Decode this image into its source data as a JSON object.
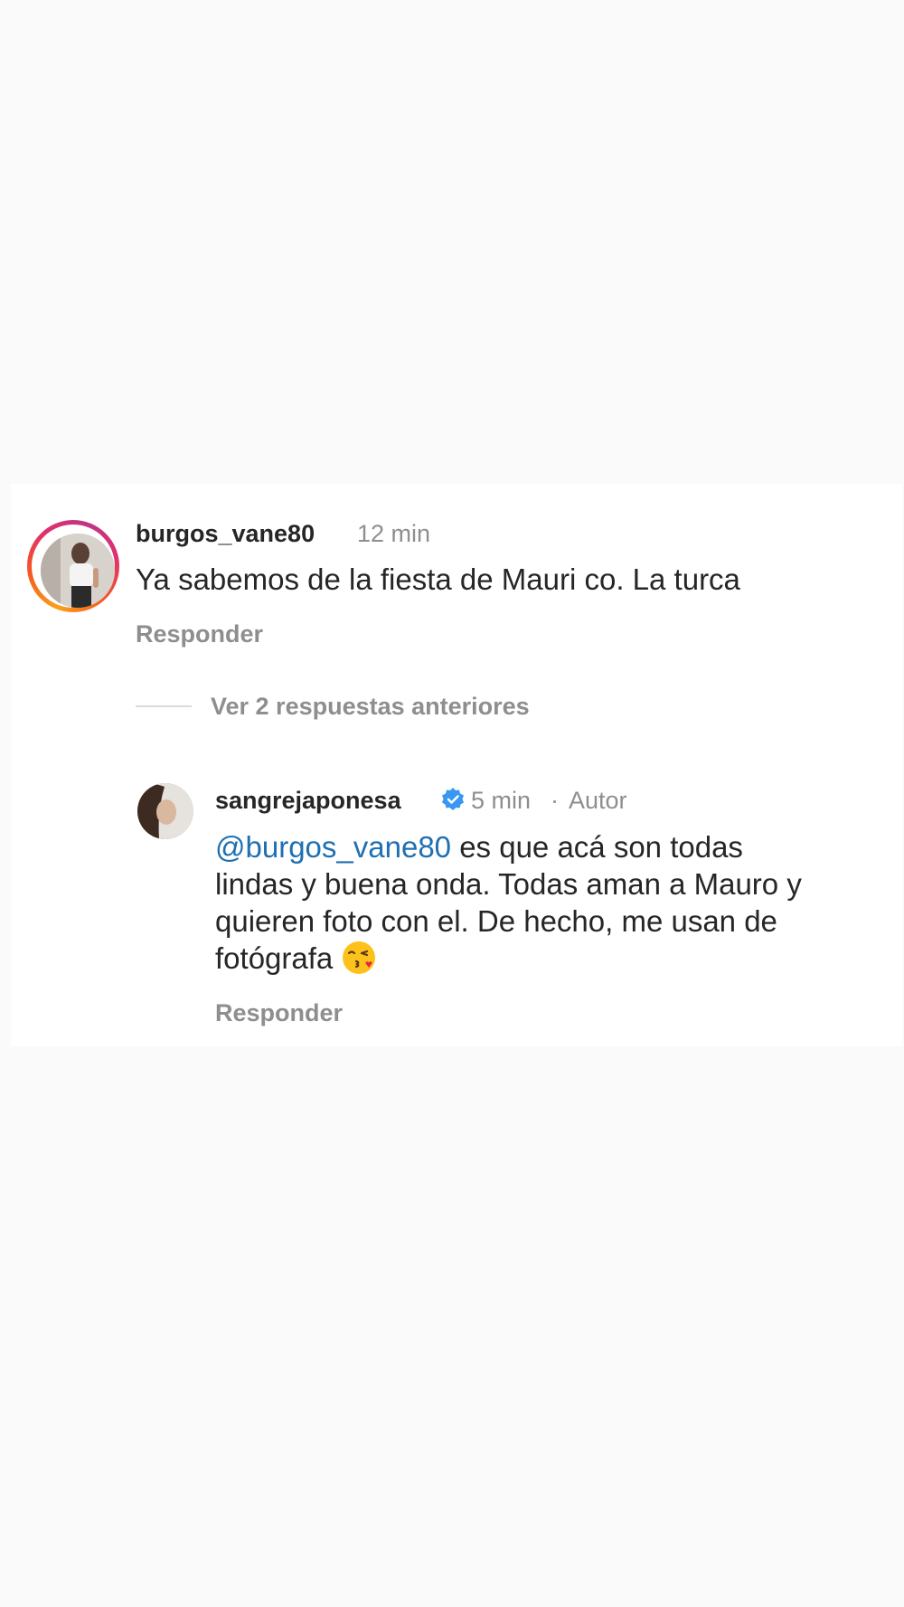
{
  "comment": {
    "username": "burgos_vane80",
    "time": "12 min",
    "text": "Ya sabemos de la fiesta de Mauri co. La turca",
    "reply_label": "Responder"
  },
  "view_replies": "Ver 2 respuestas anteriores",
  "reply": {
    "username": "sangrejaponesa",
    "time": "5 min",
    "separator": "·",
    "author_badge": "Autor",
    "mention": "@burgos_vane80",
    "line1_rest": " es que acá son todas",
    "line2": "lindas y buena onda. Todas aman a Mauro y",
    "line3": "quieren foto con el. De hecho, me usan de",
    "line4": "fotógrafa",
    "emoji_icon": "kissing-face-icon",
    "reply_label": "Responder"
  },
  "colors": {
    "mention": "#1f6fb2",
    "verified": "#3897f0"
  }
}
